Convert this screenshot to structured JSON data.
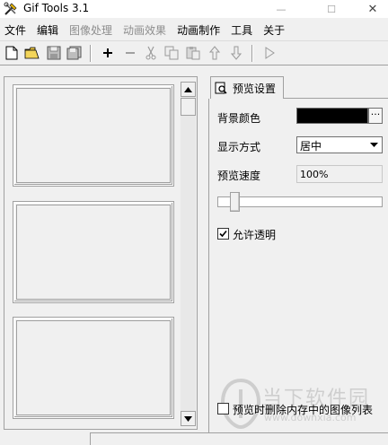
{
  "window": {
    "title": "Gif Tools 3.1",
    "minimize_glyph": "—",
    "maximize_glyph": "☐",
    "close_glyph": "✕"
  },
  "menu": [
    {
      "label": "文件",
      "enabled": true
    },
    {
      "label": "编辑",
      "enabled": true
    },
    {
      "label": "图像处理",
      "enabled": false
    },
    {
      "label": "动画效果",
      "enabled": false
    },
    {
      "label": "动画制作",
      "enabled": true
    },
    {
      "label": "工具",
      "enabled": true
    },
    {
      "label": "关于",
      "enabled": true
    }
  ],
  "toolbar": {
    "icons": [
      "new-file-icon",
      "open-folder-icon",
      "save-icon",
      "save-all-icon",
      "add-frame-icon",
      "remove-frame-icon",
      "cut-icon",
      "copy-icon",
      "paste-icon",
      "move-up-icon",
      "move-down-icon",
      "play-icon"
    ]
  },
  "preview_panel": {
    "tab_label": "预览设置",
    "background_color_label": "背景颜色",
    "background_color": "#000000",
    "ellipsis": "···",
    "display_mode_label": "显示方式",
    "display_mode_value": "居中",
    "preview_speed_label": "预览速度",
    "preview_speed_value": "100%",
    "allow_transparent_label": "允许透明",
    "allow_transparent_checked": true,
    "delete_on_preview_label": "预览时删除内存中的图像列表",
    "delete_on_preview_checked": false
  },
  "watermark": {
    "line1": "当下软件园",
    "line2": "www.downxia.com"
  }
}
